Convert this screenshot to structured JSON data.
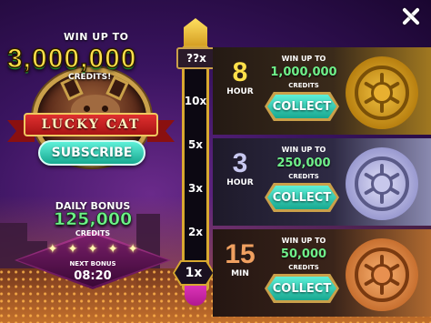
{
  "promo": {
    "win_up_to": "WIN UP TO",
    "amount": "3,000,000",
    "credits": "CREDITS!",
    "game_name": "LUCKY CAT",
    "subscribe_label": "SUBSCRIBE"
  },
  "daily_bonus": {
    "title": "DAILY BONUS",
    "amount": "125,000",
    "credits": "CREDITS",
    "stars_filled": 5,
    "next_bonus_label": "NEXT BONUS",
    "timer": "08:20"
  },
  "multiplier": {
    "top_label": "??x",
    "levels": [
      "10x",
      "5x",
      "3x",
      "2x"
    ],
    "current": "1x"
  },
  "rewards": [
    {
      "duration": "8",
      "unit": "HOUR",
      "win_up_to": "WIN UP TO",
      "amount": "1,000,000",
      "credits": "CREDITS",
      "collect_label": "COLLECT",
      "vault": "gold",
      "number_color": "#ffe14a"
    },
    {
      "duration": "3",
      "unit": "HOUR",
      "win_up_to": "WIN UP TO",
      "amount": "250,000",
      "credits": "CREDITS",
      "collect_label": "COLLECT",
      "vault": "silver",
      "number_color": "#c8c8f0"
    },
    {
      "duration": "15",
      "unit": "MIN",
      "win_up_to": "WIN UP TO",
      "amount": "50,000",
      "credits": "CREDITS",
      "collect_label": "COLLECT",
      "vault": "bronze",
      "number_color": "#f0a060"
    }
  ],
  "close_icon": "close-icon",
  "colors": {
    "green_text": "#6ff08a",
    "gold": "#caa04a",
    "teal_button": "#18a890"
  }
}
